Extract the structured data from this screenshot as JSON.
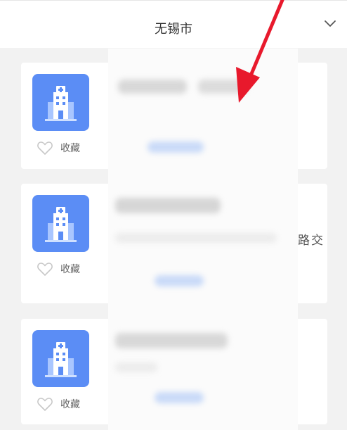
{
  "header": {
    "title": "无锡市",
    "dropdown_icon": "chevron-down-icon"
  },
  "cards": [
    {
      "icon": "hospital-building-icon",
      "favorite_label": "收藏"
    },
    {
      "icon": "hospital-building-icon",
      "favorite_label": "收藏",
      "partial_text": "路交"
    },
    {
      "icon": "hospital-building-icon",
      "favorite_label": "收藏"
    }
  ],
  "colors": {
    "icon_background": "#5b8df5",
    "annotation_arrow": "#e8192c",
    "page_background": "#f2f2f2"
  }
}
